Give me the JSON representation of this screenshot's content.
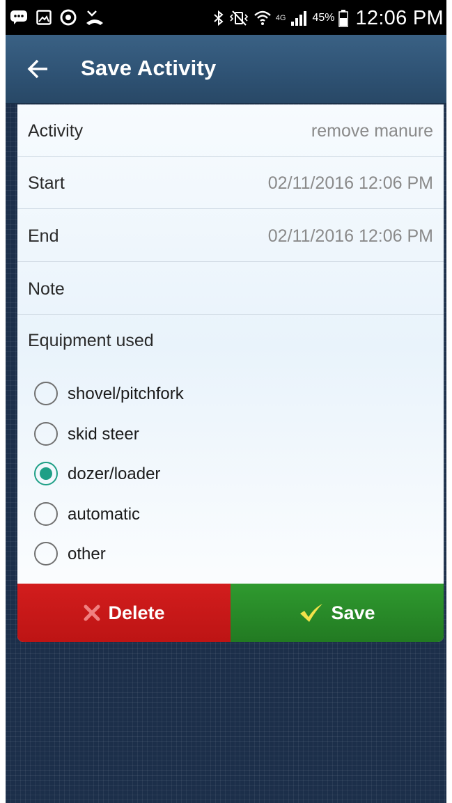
{
  "status_bar": {
    "battery_percent": "45%",
    "time": "12:06 PM",
    "network": "4G",
    "icons": [
      "message-icon",
      "gallery-icon",
      "circle-app-icon",
      "missed-call-icon",
      "bluetooth-icon",
      "vibrate-icon",
      "wifi-icon",
      "signal-icon",
      "battery-icon"
    ]
  },
  "app_bar": {
    "title": "Save Activity",
    "back_icon": "back-arrow-icon"
  },
  "fields": {
    "activity": {
      "label": "Activity",
      "value": "remove manure"
    },
    "start": {
      "label": "Start",
      "value": "02/11/2016 12:06 PM"
    },
    "end": {
      "label": "End",
      "value": "02/11/2016 12:06 PM"
    },
    "note": {
      "label": "Note",
      "value": ""
    }
  },
  "equipment": {
    "title": "Equipment used",
    "options": [
      {
        "label": "shovel/pitchfork",
        "checked": false
      },
      {
        "label": "skid steer",
        "checked": false
      },
      {
        "label": "dozer/loader",
        "checked": true
      },
      {
        "label": "automatic",
        "checked": false
      },
      {
        "label": "other",
        "checked": false
      }
    ]
  },
  "buttons": {
    "delete_label": "Delete",
    "save_label": "Save"
  },
  "colors": {
    "accent_radio": "#1e9f86",
    "delete": "#c81818",
    "save": "#2a8a2a",
    "app_bar": "#2f5375"
  }
}
